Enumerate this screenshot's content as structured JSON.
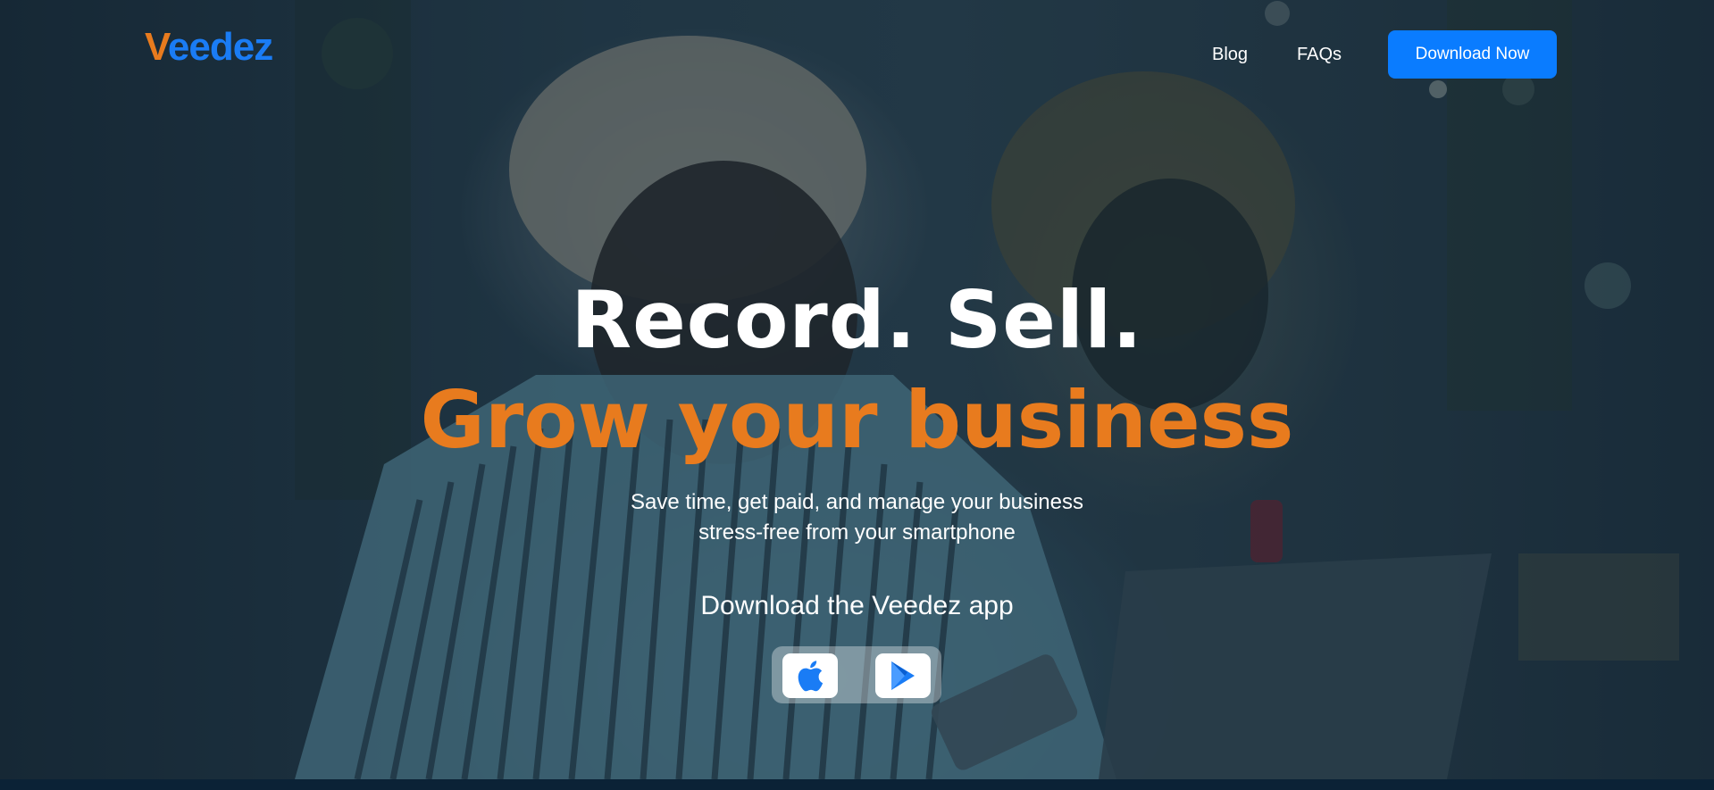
{
  "brand": {
    "logo_text": "Veedez",
    "logo_first": "V",
    "logo_rest": "eedez"
  },
  "nav": {
    "blog": "Blog",
    "faqs": "FAQs",
    "download_button": "Download Now"
  },
  "hero": {
    "headline_line1": "Record. Sell.",
    "headline_line2": "Grow your business",
    "subtitle_line1": "Save time, get paid, and manage your business",
    "subtitle_line2": "stress-free from your smartphone",
    "app_heading": "Download the Veedez app"
  },
  "store_buttons": [
    {
      "icon": "apple-icon"
    },
    {
      "icon": "google-play-icon"
    }
  ],
  "colors": {
    "brand_blue": "#0a7cff",
    "accent_orange": "#e87b1e",
    "text_white": "#ffffff",
    "background_dark": "#0b2236"
  }
}
